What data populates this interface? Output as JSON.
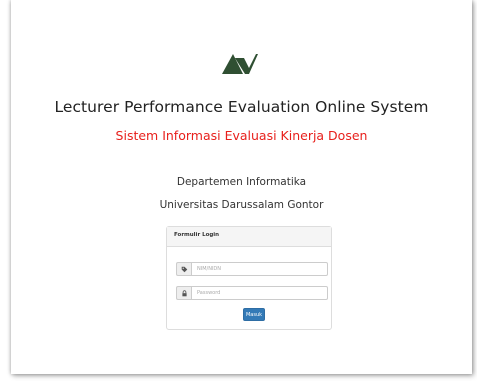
{
  "header": {
    "logo_icon": "av-mountain-logo-icon",
    "logo_color": "#2f4f32",
    "title": "Lecturer Performance Evaluation Online System",
    "subtitle": "Sistem Informasi Evaluasi Kinerja Dosen",
    "subtitle_color": "#e8201c"
  },
  "institution": {
    "department": "Departemen Informatika",
    "university": "Universitas Darussalam Gontor"
  },
  "login_form": {
    "heading": "Formulir Login",
    "username": {
      "icon": "tag-icon",
      "placeholder": "NIM/NIDN",
      "value": ""
    },
    "password": {
      "icon": "lock-icon",
      "placeholder": "Password",
      "value": ""
    },
    "submit_label": "Masuk",
    "button_color": "#337ab7"
  }
}
